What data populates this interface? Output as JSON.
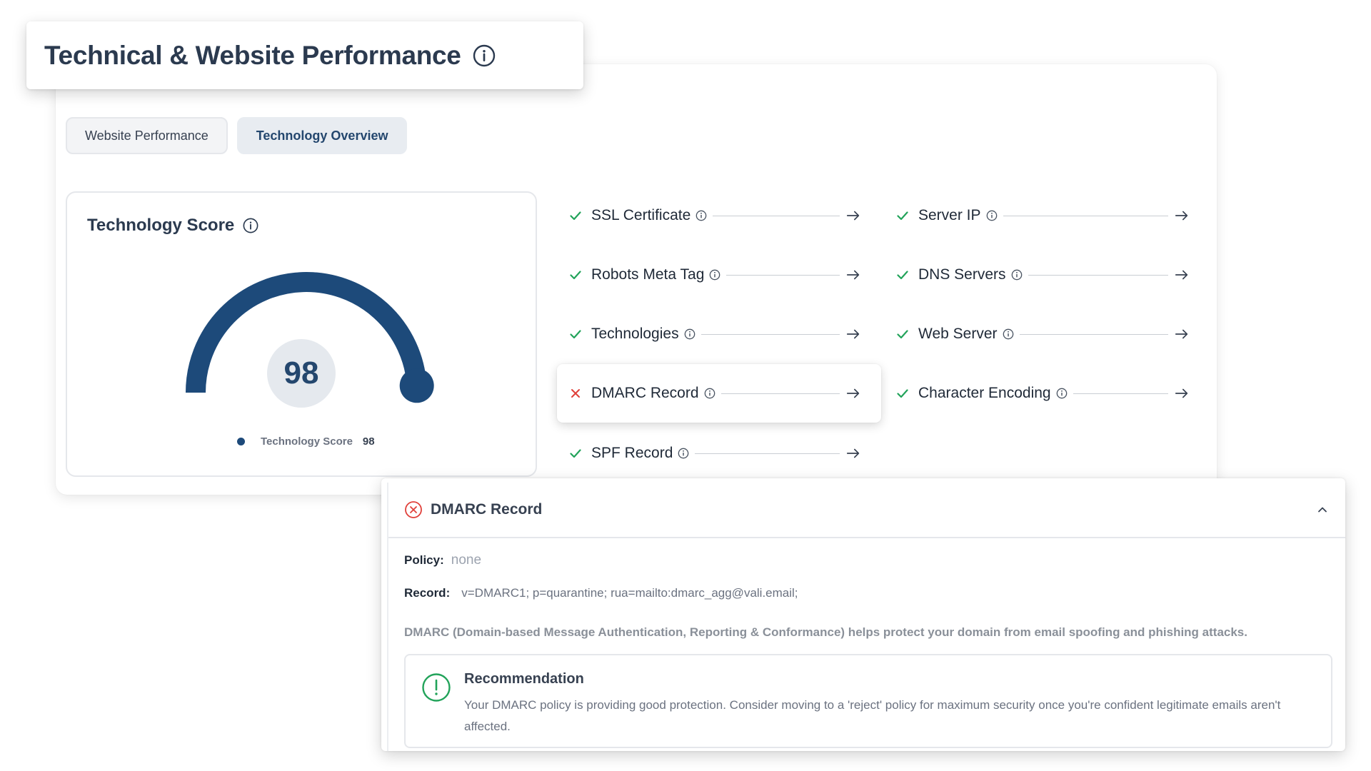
{
  "header": {
    "title": "Technical & Website Performance"
  },
  "tabs": [
    {
      "label": "Website Performance",
      "active": false
    },
    {
      "label": "Technology Overview",
      "active": true
    }
  ],
  "score_card": {
    "title": "Technology Score",
    "score": "98",
    "score_value": 98,
    "score_max": 100,
    "legend_label": "Technology Score",
    "legend_value": "98",
    "accent_color": "#1d4a7a"
  },
  "checks": {
    "left": [
      {
        "label": "SSL Certificate",
        "status": "pass"
      },
      {
        "label": "Robots Meta Tag",
        "status": "pass"
      },
      {
        "label": "Technologies",
        "status": "pass"
      },
      {
        "label": "DMARC Record",
        "status": "fail"
      },
      {
        "label": "SPF Record",
        "status": "pass"
      }
    ],
    "right": [
      {
        "label": "Server IP",
        "status": "pass"
      },
      {
        "label": "DNS Servers",
        "status": "pass"
      },
      {
        "label": "Web Server",
        "status": "pass"
      },
      {
        "label": "Character Encoding",
        "status": "pass"
      }
    ],
    "pass_color": "#22a35a",
    "fail_color": "#e0403a"
  },
  "detail": {
    "title": "DMARC Record",
    "policy_label": "Policy:",
    "policy_value": "none",
    "record_label": "Record:",
    "record_value": "v=DMARC1; p=quarantine; rua=mailto:dmarc_agg@vali.email;",
    "description": "DMARC (Domain-based Message Authentication, Reporting & Conformance) helps protect your domain from email spoofing and phishing attacks.",
    "recommendation_title": "Recommendation",
    "recommendation_text": "Your DMARC policy is providing good protection. Consider moving to a 'reject' policy for maximum security once you're confident legitimate emails aren't affected."
  }
}
